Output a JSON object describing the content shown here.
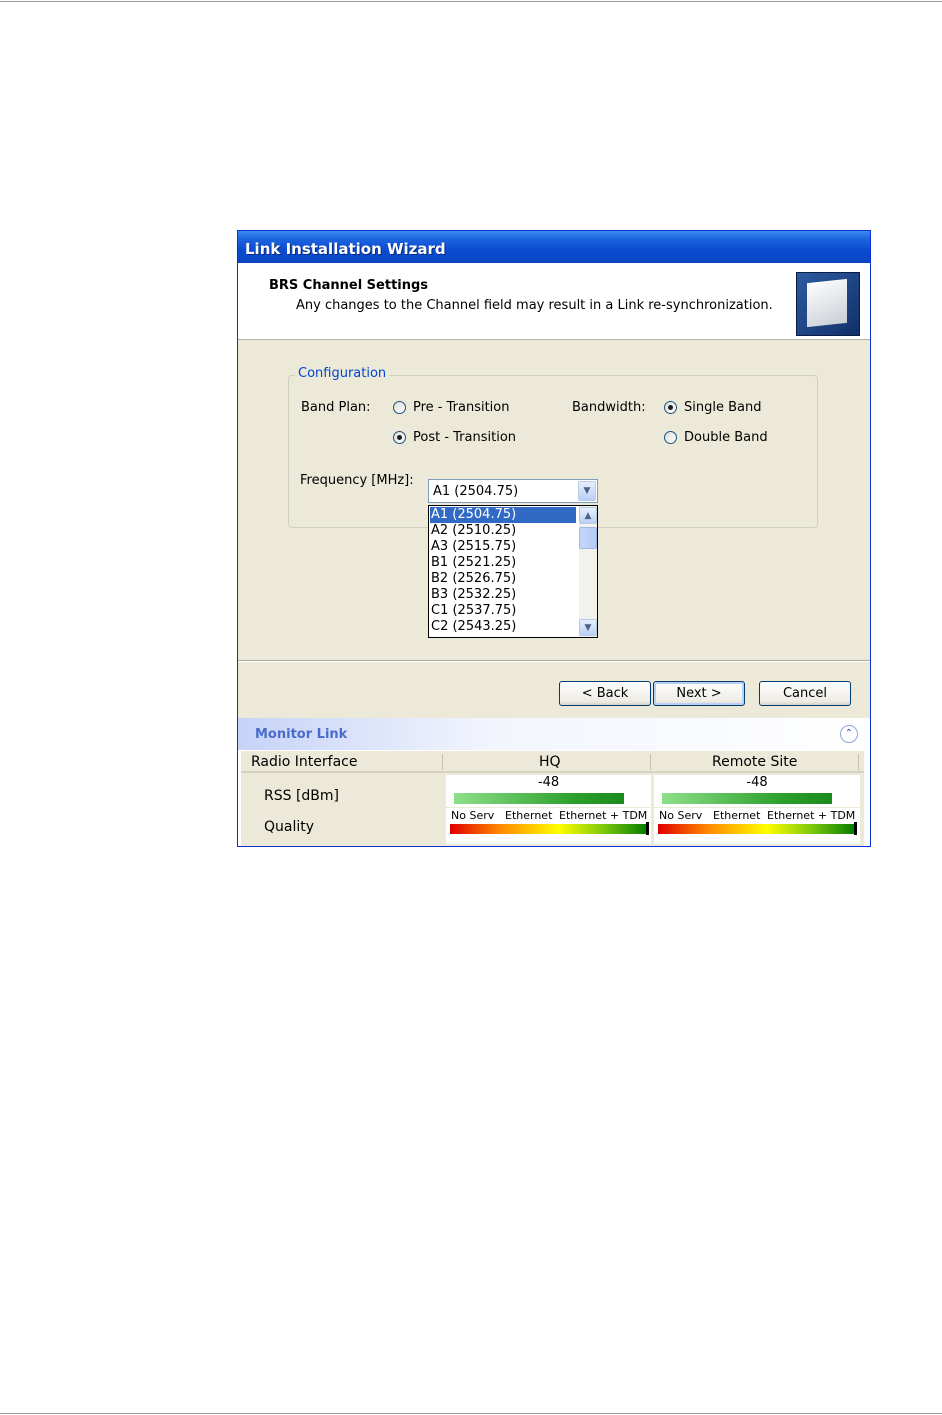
{
  "window": {
    "title": "Link Installation Wizard"
  },
  "header": {
    "title": "BRS Channel Settings",
    "subtitle": "Any changes to the Channel field may result in a Link re-synchronization."
  },
  "config": {
    "legend": "Configuration",
    "band_plan_label": "Band Plan:",
    "band_plan_options": [
      "Pre - Transition",
      "Post - Transition"
    ],
    "band_plan_selected": "Post - Transition",
    "bandwidth_label": "Bandwidth:",
    "bandwidth_options": [
      "Single Band",
      "Double Band"
    ],
    "bandwidth_selected": "Single Band",
    "frequency_label": "Frequency [MHz]:",
    "frequency_value": "A1 (2504.75)",
    "frequency_options": [
      "A1 (2504.75)",
      "A2 (2510.25)",
      "A3 (2515.75)",
      "B1 (2521.25)",
      "B2 (2526.75)",
      "B3 (2532.25)",
      "C1 (2537.75)",
      "C2 (2543.25)"
    ]
  },
  "buttons": {
    "back": "< Back",
    "next": "Next >",
    "cancel": "Cancel"
  },
  "monitor": {
    "title": "Monitor Link",
    "columns": [
      "Radio Interface",
      "HQ",
      "Remote Site"
    ],
    "rss_label": "RSS [dBm]",
    "quality_label": "Quality",
    "hq_rss": "-48",
    "remote_rss": "-48",
    "quality_scale": [
      "No Serv",
      "Ethernet",
      "Ethernet + TDM"
    ]
  },
  "colors": {
    "title_bar": "#0a46c2",
    "accent": "#316ac5",
    "monitor_title": "#4b6bc9"
  }
}
